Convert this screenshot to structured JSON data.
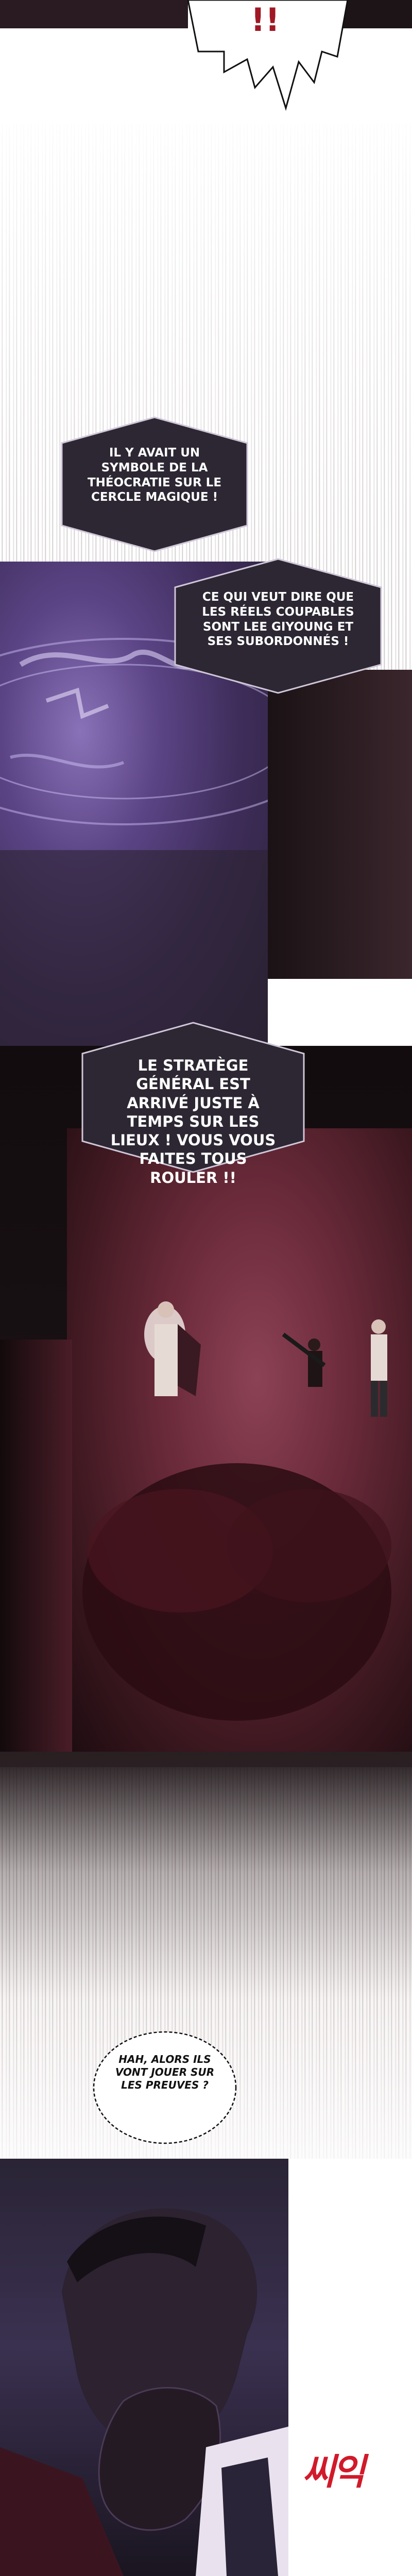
{
  "colors": {
    "bubble_dark_fill": "#2c2732",
    "bubble_border": "#cfc6d8",
    "magic_purple": "#4b3766",
    "blood_red": "#6a1f2d",
    "sfx_red": "#d11a2a"
  },
  "panels": {
    "top_shout": {
      "text": "!!"
    },
    "bubble_1": {
      "text": "IL Y AVAIT UN SYMBOLE DE LA THÉOCRATIE SUR LE CERCLE MAGIQUE !"
    },
    "bubble_2": {
      "text": "CE QUI VEUT DIRE QUE LES RÉELS COUPABLES SONT LEE GIYOUNG ET SES SUBORDONNÉS !"
    },
    "bubble_3": {
      "text": "LE STRATÈGE GÉNÉRAL EST ARRIVÉ JUSTE À TEMPS SUR LES LIEUX ! VOUS VOUS FAITES TOUS ROULER !!"
    },
    "bubble_4": {
      "text": "HAH, ALORS ILS VONT JOUER SUR LES PREUVES ?"
    },
    "sfx": {
      "text": "씨익"
    }
  }
}
